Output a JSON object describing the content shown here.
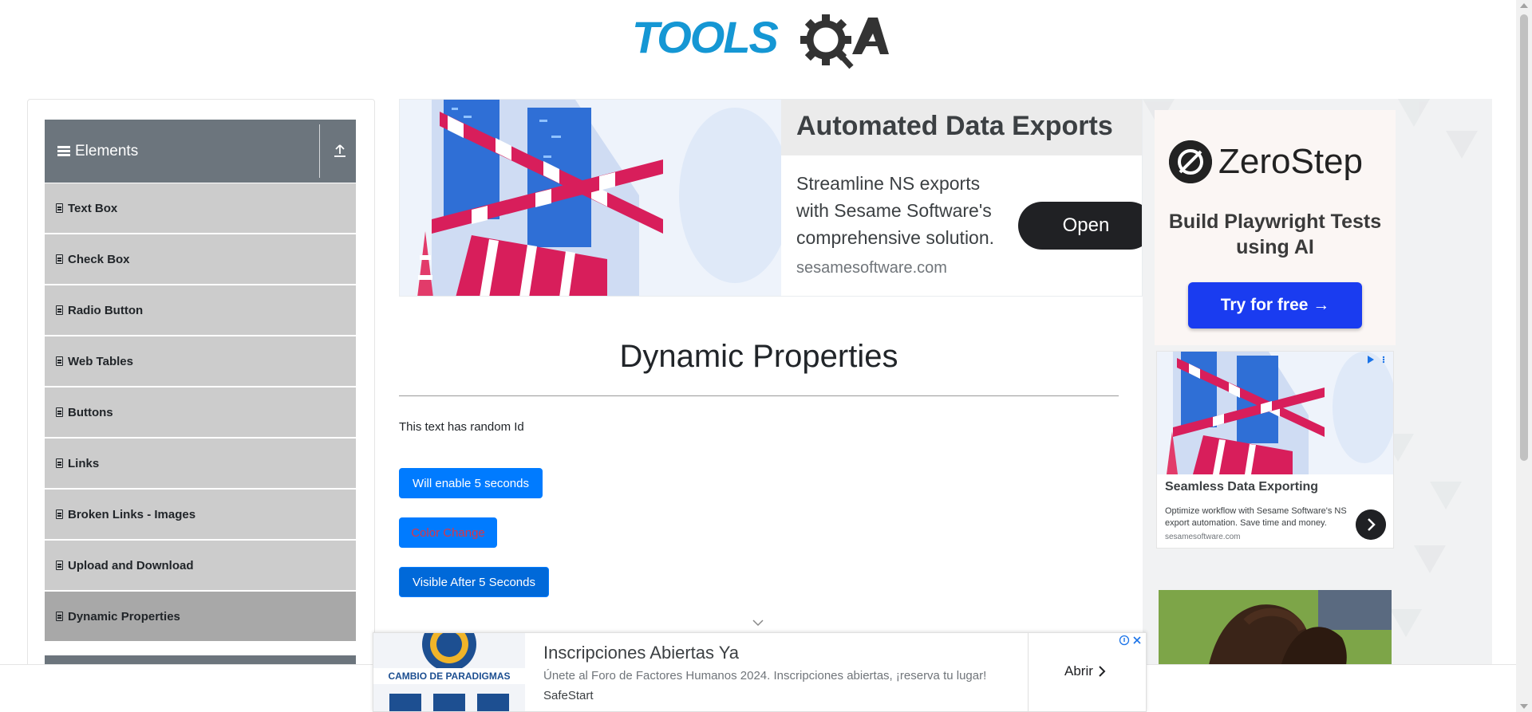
{
  "header": {
    "logo_text": "TOOLSQA"
  },
  "sidebar": {
    "group_title": "Elements",
    "items": [
      {
        "label": "Text Box",
        "active": false
      },
      {
        "label": "Check Box",
        "active": false
      },
      {
        "label": "Radio Button",
        "active": false
      },
      {
        "label": "Web Tables",
        "active": false
      },
      {
        "label": "Buttons",
        "active": false
      },
      {
        "label": "Links",
        "active": false
      },
      {
        "label": "Broken Links - Images",
        "active": false
      },
      {
        "label": "Upload and Download",
        "active": false
      },
      {
        "label": "Dynamic Properties",
        "active": true
      }
    ]
  },
  "banner_ad": {
    "title": "Automated Data Exports",
    "description": "Streamline NS exports with Sesame Software's comprehensive solution.",
    "domain": "sesamesoftware.com",
    "cta": "Open"
  },
  "main": {
    "title": "Dynamic Properties",
    "random_id_text": "This text has random Id",
    "enable_button": "Will enable 5 seconds",
    "color_button": "Color Change",
    "visible_button": "Visible After 5 Seconds"
  },
  "right_ads": {
    "zerostep": {
      "brand": "ZeroStep",
      "tagline": "Build Playwright Tests using AI",
      "cta": "Try for free →"
    },
    "sesame": {
      "title": "Seamless Data Exporting",
      "description": "Optimize workflow with Sesame Software's NS export automation. Save time and money.",
      "domain": "sesamesoftware.com"
    }
  },
  "bottom_ad": {
    "title": "Inscripciones Abiertas Ya",
    "description": "Únete al Foro de Factores Humanos 2024. Inscripciones abiertas, ¡reserva tu lugar!",
    "advertiser": "SafeStart",
    "cta": "Abrir",
    "image_text": "CAMBIO DE PARADIGMAS"
  },
  "colors": {
    "primary_button": "#007bff",
    "sidebar_header": "#6c757d",
    "sidebar_item": "#cccccc",
    "sidebar_item_active": "#a8a8a8",
    "logo_blue": "#1597d4",
    "logo_dark": "#333333"
  }
}
